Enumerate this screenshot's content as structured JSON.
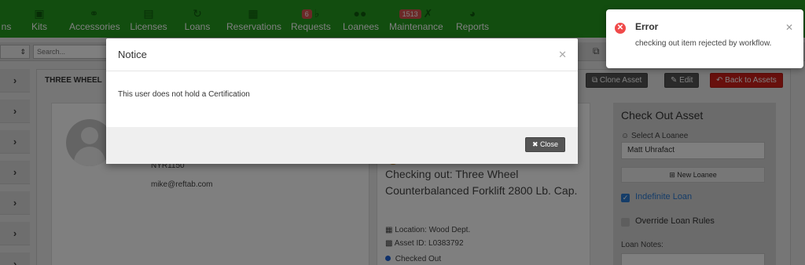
{
  "nav": {
    "items": [
      {
        "label": "ns",
        "icon": "box-icon"
      },
      {
        "label": "Kits",
        "icon": "briefcase-icon"
      },
      {
        "label": "Accessories",
        "icon": "bicycle-icon"
      },
      {
        "label": "Licenses",
        "icon": "save-icon"
      },
      {
        "label": "Loans",
        "icon": "refresh-icon"
      },
      {
        "label": "Reservations",
        "icon": "calendar-icon"
      },
      {
        "label": "Requests",
        "icon": "bell-icon",
        "badge": "6"
      },
      {
        "label": "Loanees",
        "icon": "users-icon"
      },
      {
        "label": "Maintenance",
        "icon": "wrench-icon",
        "badge": "1513"
      },
      {
        "label": "Reports",
        "icon": "pie-chart-icon"
      }
    ]
  },
  "subbar": {
    "search_placeholder": "Search..."
  },
  "breadcrumb": "THREE WHEEL",
  "header_buttons": {
    "clone": "Clone Asset",
    "edit": "Edit",
    "back": "Back to Assets"
  },
  "profile": {
    "user_id": "NYR1150",
    "email": "mike@reftab.com"
  },
  "checkout_info": {
    "title": "Checking out: Three Wheel Counterbalanced Forklift 2800 Lb. Cap.",
    "location": "Location: Wood Dept.",
    "asset_id": "Asset ID: L0383792",
    "status": "Checked Out"
  },
  "checkout_panel": {
    "title": "Check Out Asset",
    "select_label": "Select A Loanee",
    "loanee_value": "Matt Uhrafact",
    "new_loanee": "New Loanee",
    "indefinite_label": "Indefinite Loan",
    "indefinite_checked": true,
    "override_label": "Override Loan Rules",
    "override_checked": false,
    "notes_label": "Loan Notes:"
  },
  "modal": {
    "title": "Notice",
    "body": "This user does not hold a Certification",
    "close_label": "Close"
  },
  "toast": {
    "title": "Error",
    "message": "checking out item rejected by workflow."
  },
  "colors": {
    "nav_green": "#249a1f",
    "danger_red": "#d0201b",
    "toast_icon_red": "#f04a4a",
    "check_blue": "#2a7ad2"
  }
}
